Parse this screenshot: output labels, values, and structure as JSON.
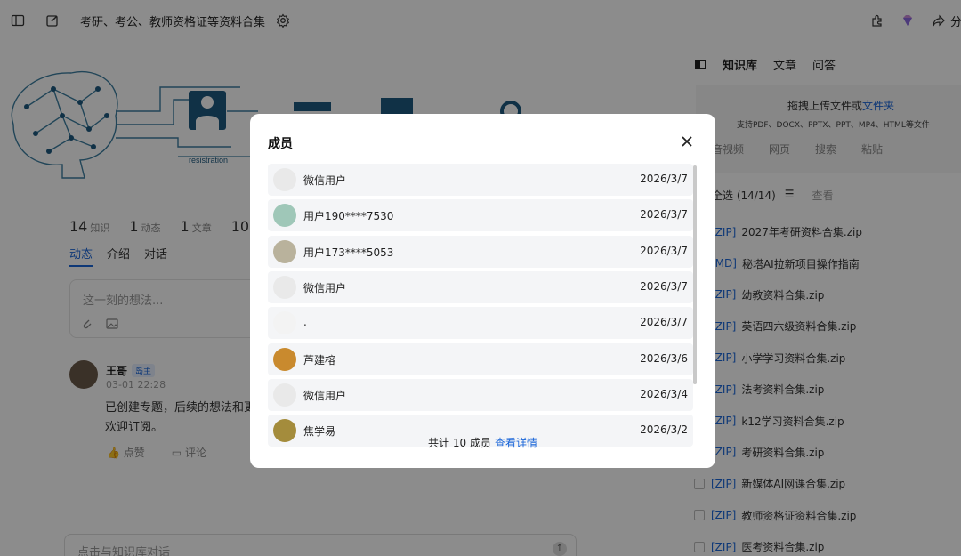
{
  "header": {
    "title": "考研、考公、教师资格证等资料合集",
    "share_label": "分"
  },
  "hero": {
    "caption": "resistration"
  },
  "stats": [
    {
      "num": "14",
      "label": "知识"
    },
    {
      "num": "1",
      "label": "动态"
    },
    {
      "num": "1",
      "label": "文章"
    },
    {
      "num": "10",
      "label": ""
    }
  ],
  "tabs": [
    "动态",
    "介绍",
    "对话"
  ],
  "composer": {
    "placeholder": "这一刻的想法..."
  },
  "post": {
    "author": "王哥",
    "badge": "岛主",
    "time": "03-01 22:28",
    "line1": "已创建专题，后续的想法和更",
    "line2": "欢迎订阅。",
    "like_label": "点赞",
    "comment_label": "评论"
  },
  "chatbar": {
    "placeholder": "点击与知识库对话"
  },
  "right_panel": {
    "tabs": [
      "知识库",
      "文章",
      "问答"
    ],
    "upload": {
      "line1": "拖拽上传文件或",
      "link": "文件夹",
      "line2": "支持PDF、DOCX、PPTX、PPT、MP4、HTML等文件",
      "sources": [
        "音视频",
        "网页",
        "搜索",
        "粘贴"
      ]
    },
    "select_all": "全选 (14/14)",
    "view": "查看",
    "files": [
      {
        "tag": "[ZIP]",
        "name": "2027年考研资料合集.zip"
      },
      {
        "tag": "[MD]",
        "name": "秘塔AI拉新项目操作指南"
      },
      {
        "tag": "[ZIP]",
        "name": "幼教资料合集.zip"
      },
      {
        "tag": "[ZIP]",
        "name": "英语四六级资料合集.zip"
      },
      {
        "tag": "[ZIP]",
        "name": "小学学习资料合集.zip"
      },
      {
        "tag": "[ZIP]",
        "name": "法考资料合集.zip"
      },
      {
        "tag": "[ZIP]",
        "name": "k12学习资料合集.zip"
      },
      {
        "tag": "[ZIP]",
        "name": "考研资料合集.zip"
      },
      {
        "tag": "[ZIP]",
        "name": "新媒体AI网课合集.zip"
      },
      {
        "tag": "[ZIP]",
        "name": "教师资格证资料合集.zip"
      },
      {
        "tag": "[ZIP]",
        "name": "医考资料合集.zip"
      }
    ]
  },
  "modal": {
    "title": "成员",
    "members": [
      {
        "name": "微信用户",
        "date": "2026/3/7",
        "avatar_color": "#e9e9e9"
      },
      {
        "name": "用户190****7530",
        "date": "2026/3/7",
        "avatar_color": "#9fc7b8"
      },
      {
        "name": "用户173****5053",
        "date": "2026/3/7",
        "avatar_color": "#b9b29c"
      },
      {
        "name": "微信用户",
        "date": "2026/3/7",
        "avatar_color": "#e9e9e9"
      },
      {
        "name": ".",
        "date": "2026/3/7",
        "avatar_color": "#f3f3f3"
      },
      {
        "name": "芦建榕",
        "date": "2026/3/6",
        "avatar_color": "#c98a2e"
      },
      {
        "name": "微信用户",
        "date": "2026/3/4",
        "avatar_color": "#e9e9e9"
      },
      {
        "name": "焦学易",
        "date": "2026/3/2",
        "avatar_color": "#a48c3c"
      }
    ],
    "footer_text": "共计 10 成员",
    "footer_link": "查看详情"
  }
}
